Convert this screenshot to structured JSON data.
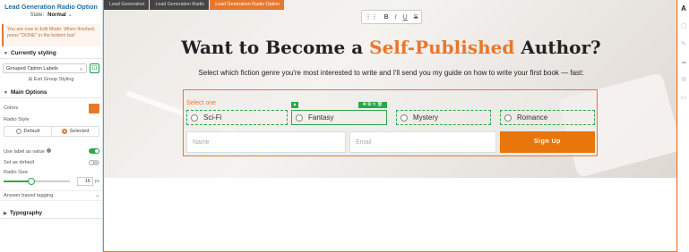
{
  "panel": {
    "title": "Lead Generation Radio Option",
    "state_label": "State:",
    "state_value": "Normal",
    "state_chevron": "⌄",
    "edit_note": "You are now in Edit Mode. When finished, press \"DONE\" in the bottom bar!",
    "currently_styling": {
      "heading": "Currently styling",
      "select_value": "Grouped Option Labels",
      "exit_group": "Exit Group Styling"
    },
    "main_options": {
      "heading": "Main Options",
      "colors_label": "Colors",
      "color_value": "#e8772e",
      "radio_style_label": "Radio Style",
      "radio_default": "Default",
      "radio_selected": "Selected",
      "use_label_as_value": "Use label as value",
      "use_label_as_value_on": true,
      "set_as_default": "Set as default",
      "set_as_default_on": false,
      "radio_size_label": "Radio Size",
      "radio_size_value": "16",
      "radio_size_unit": "px",
      "radio_size_fraction": 0.42,
      "answer_tagging": "Answer based tagging"
    },
    "typography_heading": "Typography"
  },
  "breadcrumbs": [
    "Lead Generation",
    "Lead Generation Radio",
    "Lead Generation Radio Option"
  ],
  "format_toolbar": [
    "⋮⋮",
    "B",
    "I",
    "U",
    "S"
  ],
  "hero": {
    "headline_pre": "Want to Become a ",
    "headline_highlight": "Self-Published",
    "headline_post": " Author?",
    "subline": "Select which fiction genre you're most interested to write and I'll send you my guide on how to write your first book — fast:"
  },
  "form": {
    "select_one": "Select one",
    "options": [
      "Sci-Fi",
      "Fantasy",
      "Mystery",
      "Romance"
    ],
    "name_placeholder": "Name",
    "email_placeholder": "Email",
    "submit": "Sign Up"
  },
  "right_bar_icons": [
    "A",
    "▢",
    "✎",
    "☁",
    "⚙",
    "▭"
  ]
}
